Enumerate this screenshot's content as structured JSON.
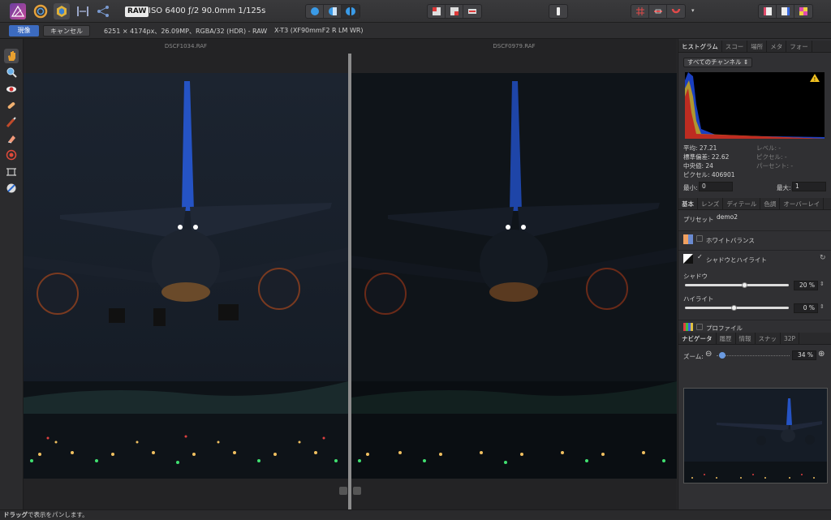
{
  "toolbar": {
    "raw_badge": "RAW",
    "exif": "ISO 6400 ƒ/2 90.0mm 1/125s",
    "icons": [
      "photo-persona-icon",
      "liquify-persona-icon",
      "develop-persona-icon",
      "tone-mapping-persona-icon",
      "export-persona-icon"
    ]
  },
  "context": {
    "develop_label": "現像",
    "cancel_label": "キャンセル",
    "image_info": "6251 × 4174px、26.09MP、RGBA/32 (HDR) - RAW",
    "camera_info": "X-T3 (XF90mmF2 R LM WR)"
  },
  "canvas": {
    "left_filename": "DSCF1034.RAF",
    "right_filename": "DSCF0979.RAF"
  },
  "histogram_panel": {
    "tabs": [
      "ヒストグラム",
      "スコー",
      "場所",
      "メタ",
      "フォー"
    ],
    "channel": "すべてのチャンネル",
    "stats": {
      "mean_label": "平均: 27.21",
      "std_label": "標準偏差: 22.62",
      "median_label": "中央値: 24",
      "pixels_label": "ピクセル: 406901",
      "level_label": "レベル: -",
      "pixel_label": "ピクセル: -",
      "percent_label": "パーセント: -"
    },
    "min_label": "最小:",
    "min_value": "0",
    "max_label": "最大:",
    "max_value": "1"
  },
  "basic_panel": {
    "tabs": [
      "基本",
      "レンズ",
      "ディテール",
      "色調",
      "オーバーレイ"
    ],
    "preset_label": "プリセット:",
    "preset_value": "demo2",
    "white_balance": "ホワイトバランス",
    "shadows_highlights": "シャドウとハイライト",
    "shadows_label": "シャドウ",
    "shadows_value": "20 %",
    "shadows_level": 0.2,
    "highlights_label": "ハイライト",
    "highlights_value": "0 %",
    "highlights_level": 0.0,
    "profile": "プロファイル"
  },
  "navigator_panel": {
    "tabs": [
      "ナビゲータ",
      "履歴",
      "情報",
      "スナッ",
      "32P"
    ],
    "zoom_label": "ズーム:",
    "zoom_value": "34 %"
  },
  "status": {
    "bold": "ドラッグ",
    "text": "で表示をパンします。"
  }
}
